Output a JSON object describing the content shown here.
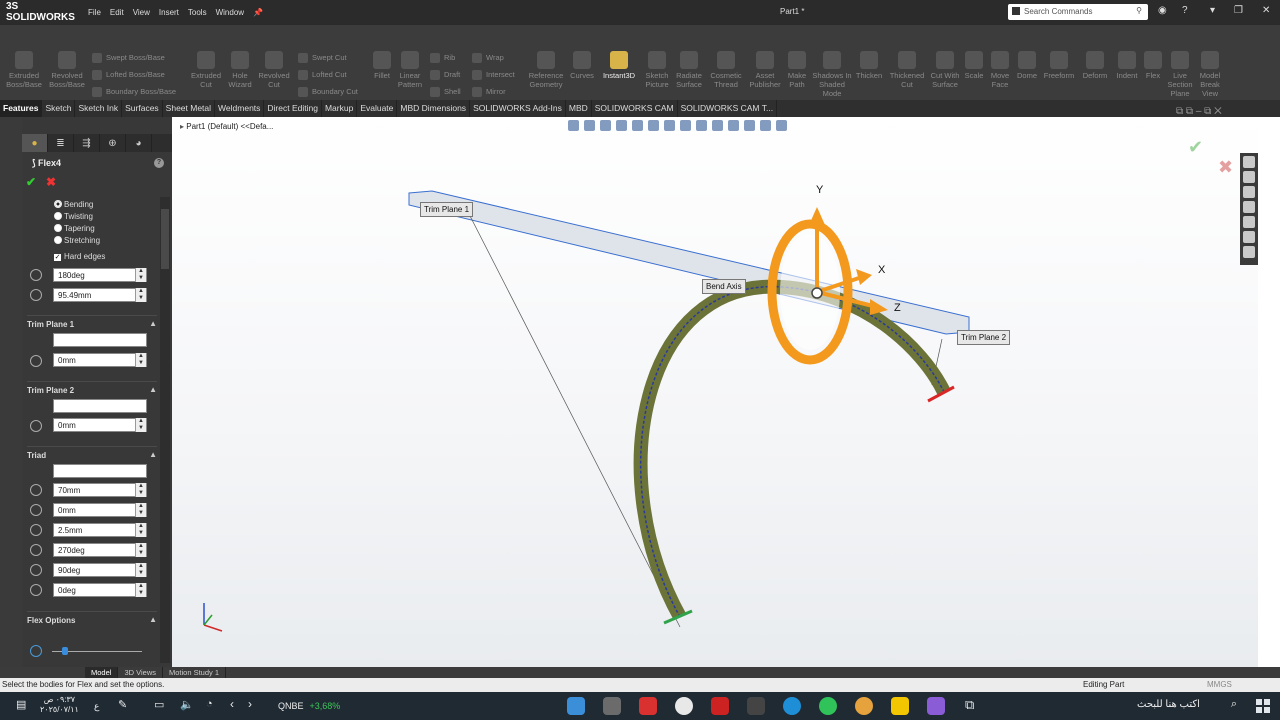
{
  "titlebar": {
    "logo_prefix": "3S",
    "logo": "SOLIDWORKS",
    "menu": [
      "File",
      "Edit",
      "View",
      "Insert",
      "Tools",
      "Window"
    ],
    "document": "Part1 *",
    "search_placeholder": "Search Commands"
  },
  "ribbon": {
    "extruded_boss": "Extruded Boss/Base",
    "revolved_boss": "Revolved Boss/Base",
    "swept_boss": "Swept Boss/Base",
    "lofted_boss": "Lofted Boss/Base",
    "boundary_boss": "Boundary Boss/Base",
    "extruded_cut": "Extruded Cut",
    "hole_wizard": "Hole Wizard",
    "revolved_cut": "Revolved Cut",
    "swept_cut": "Swept Cut",
    "lofted_cut": "Lofted Cut",
    "boundary_cut": "Boundary Cut",
    "fillet": "Fillet",
    "linear_pattern": "Linear Pattern",
    "rib": "Rib",
    "draft": "Draft",
    "shell": "Shell",
    "wrap": "Wrap",
    "intersect": "Intersect",
    "mirror": "Mirror",
    "reference_geometry": "Reference Geometry",
    "curves": "Curves",
    "instant3d": "Instant3D",
    "sketch_picture": "Sketch Picture",
    "radiate_surface": "Radiate Surface",
    "cosmetic_thread": "Cosmetic Thread",
    "asset_publisher": "Asset Publisher",
    "make_path": "Make Path",
    "shadows": "Shadows In Shaded Mode",
    "thicken": "Thicken",
    "thickened_cut": "Thickened Cut",
    "cut_with_surface": "Cut With Surface",
    "scale": "Scale",
    "move_face": "Move Face",
    "dome": "Dome",
    "freeform": "Freeform",
    "deform": "Deform",
    "indent": "Indent",
    "flex": "Flex",
    "live_section": "Live Section Plane",
    "model_break": "Model Break View"
  },
  "tabs": [
    "Features",
    "Sketch",
    "Sketch Ink",
    "Surfaces",
    "Sheet Metal",
    "Weldments",
    "Direct Editing",
    "Markup",
    "Evaluate",
    "MBD Dimensions",
    "SOLIDWORKS Add-Ins",
    "MBD",
    "SOLIDWORKS CAM",
    "SOLIDWORKS CAM T..."
  ],
  "panel": {
    "feature_name": "Flex4",
    "modes": [
      "Bending",
      "Twisting",
      "Tapering",
      "Stretching"
    ],
    "hard_edges": "Hard edges",
    "angle": "180deg",
    "radius": "95.49mm",
    "trim1_title": "Trim Plane 1",
    "trim1_value": "0mm",
    "trim2_title": "Trim Plane 2",
    "trim2_value": "0mm",
    "triad_title": "Triad",
    "triad_values": [
      "70mm",
      "0mm",
      "2.5mm",
      "270deg",
      "90deg",
      "0deg"
    ],
    "flex_options": "Flex Options"
  },
  "graphics": {
    "breadcrumb": "Part1 (Default) <<Defa...",
    "label_trim1": "Trim Plane 1",
    "label_trim2": "Trim Plane 2",
    "label_bend": "Bend Axis",
    "axis_x": "X",
    "axis_y": "Y",
    "axis_z": "Z"
  },
  "bottom_tabs": [
    "Model",
    "3D Views",
    "Motion Study 1"
  ],
  "status": {
    "message": "Select the bodies for Flex and set the options.",
    "mode": "Editing Part",
    "units": "MMGS"
  },
  "taskbar": {
    "time": "٠٩:٣٧ ص",
    "date": "٢٠٢٥/٠٧/١١",
    "lang": "ع",
    "stock_name": "QNBE",
    "stock_change": "+3,68%",
    "search": "اكتب هنا للبحث"
  },
  "colors": {
    "accent_orange": "#f39a1e",
    "body_olive": "#6b7338",
    "bend_blue": "#2a3a9a"
  }
}
